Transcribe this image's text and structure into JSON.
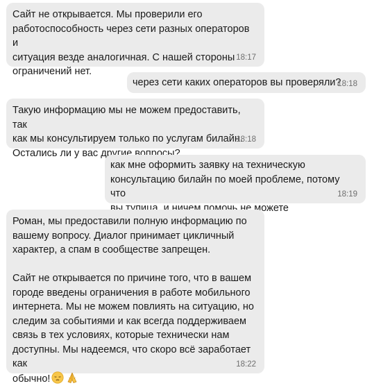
{
  "messages": [
    {
      "direction": "incoming",
      "text": "Сайт не открывается. Мы проверили его\nработоспособность через сети разных операторов и\nситуация везде аналогичная. С нашей стороны\nограничений нет.",
      "time": "18:17"
    },
    {
      "direction": "outgoing",
      "text": "через сети каких операторов вы проверяли?",
      "time": "18:18"
    },
    {
      "direction": "incoming",
      "text": "Такую информацию мы не можем предоставить, так\nкак мы консультируем только по услугам билайн.\nОстались ли у вас другие вопросы?",
      "time": "18:18"
    },
    {
      "direction": "outgoing",
      "text": "как мне оформить заявку на техническую\nконсультацию билайн по моей проблеме, потому что\nвы тупица, и ничем помочь не можете",
      "time": "18:19"
    },
    {
      "direction": "incoming",
      "text": "Роман, мы предоставили полную информацию по\nвашему вопросу. Диалог принимает цикличный\nхарактер, а спам в сообществе запрещен.\n\nСайт не открывается по причине того, что в вашем\nгороде введены ограничения в работе мобильного\nинтернета. Мы не можем повлиять на ситуацию, но\nследим за событиями и как всегда поддерживаем\nсвязь в тех условиях, которые технически нам\nдоступны. Мы надеемся, что скоро всё заработает как\nобычно!",
      "time": "18:22",
      "emojis": [
        "pensive-face-icon",
        "folded-hands-icon"
      ]
    }
  ],
  "colors": {
    "bubble_background": "#ebebeb",
    "time_text": "#6e6e6e",
    "message_text": "#1a1a1a"
  }
}
